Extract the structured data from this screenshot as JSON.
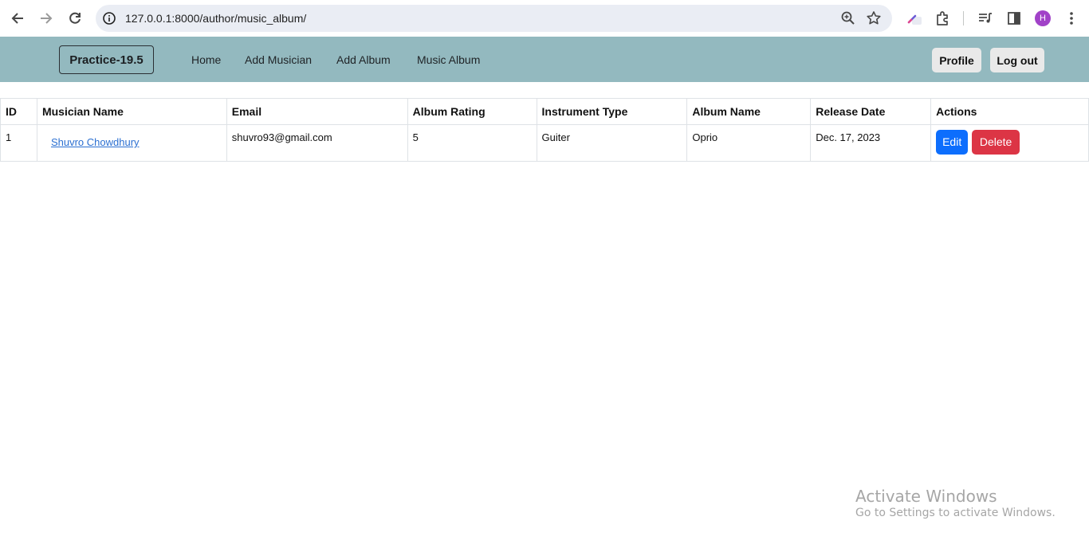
{
  "browser": {
    "url": "127.0.0.1:8000/author/music_album/",
    "avatar_letter": "H",
    "accent": "#a142c8"
  },
  "navbar": {
    "brand": "Practice-19.5",
    "links": [
      "Home",
      "Add Musician",
      "Add Album",
      "Music Album"
    ],
    "profile_label": "Profile",
    "logout_label": "Log out",
    "background": "#93b9bf"
  },
  "table": {
    "headers": [
      "ID",
      "Musician Name",
      "Email",
      "Album Rating",
      "Instrument Type",
      "Album Name",
      "Release Date",
      "Actions"
    ],
    "rows": [
      {
        "id": "1",
        "musician": "Shuvro Chowdhury",
        "email": "shuvro93@gmail.com",
        "rating": "5",
        "instrument": "Guiter",
        "album": "Oprio",
        "release_date": "Dec. 17, 2023",
        "edit_label": "Edit",
        "delete_label": "Delete"
      }
    ]
  },
  "watermark": {
    "title": "Activate Windows",
    "subtitle": "Go to Settings to activate Windows."
  }
}
